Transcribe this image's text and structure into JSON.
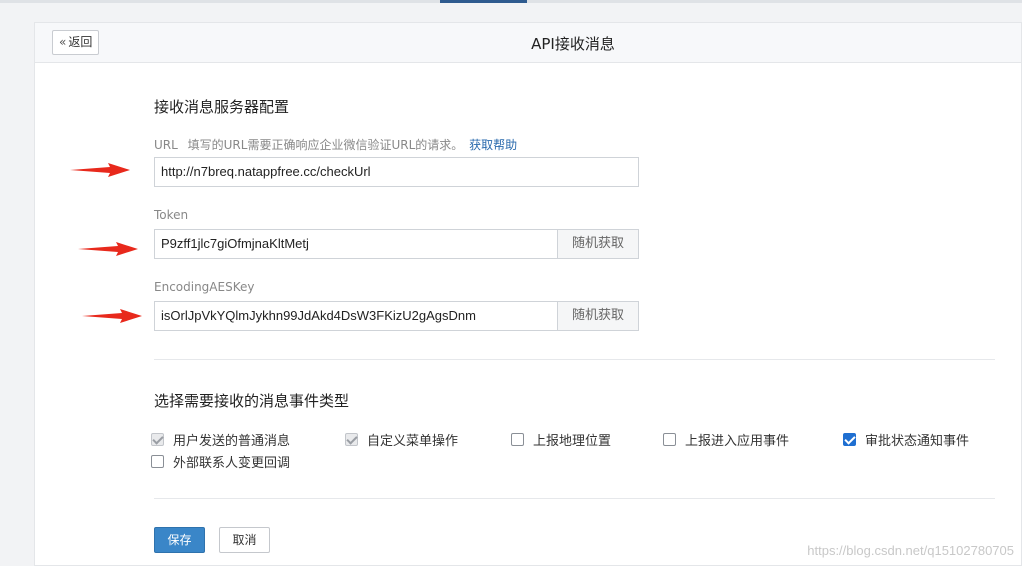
{
  "header": {
    "back_label": "返回",
    "title": "API接收消息"
  },
  "server_config": {
    "section_title": "接收消息服务器配置",
    "url": {
      "label": "URL",
      "hint": "填写的URL需要正确响应企业微信验证URL的请求。",
      "help_link": "获取帮助",
      "value": "http://n7breq.natappfree.cc/checkUrl"
    },
    "token": {
      "label": "Token",
      "value": "P9zff1jlc7giOfmjnaKltMetj",
      "random_label": "随机获取"
    },
    "aes_key": {
      "label": "EncodingAESKey",
      "value": "isOrlJpVkYQlmJykhn99JdAkd4DsW3FKizU2gAgsDnm",
      "random_label": "随机获取"
    }
  },
  "events": {
    "section_title": "选择需要接收的消息事件类型",
    "items": [
      {
        "label": "用户发送的普通消息",
        "state": "disabled-checked"
      },
      {
        "label": "自定义菜单操作",
        "state": "disabled-checked"
      },
      {
        "label": "上报地理位置",
        "state": "unchecked"
      },
      {
        "label": "上报进入应用事件",
        "state": "unchecked"
      },
      {
        "label": "审批状态通知事件",
        "state": "checked"
      },
      {
        "label": "外部联系人变更回调",
        "state": "unchecked"
      }
    ]
  },
  "actions": {
    "save_label": "保存",
    "cancel_label": "取消"
  },
  "watermark": "https://blog.csdn.net/q15102780705",
  "colors": {
    "accent": "#1f6fd1",
    "save_button": "#3a86c8",
    "link": "#2a6aad",
    "annotation_arrow": "#e8291c"
  }
}
